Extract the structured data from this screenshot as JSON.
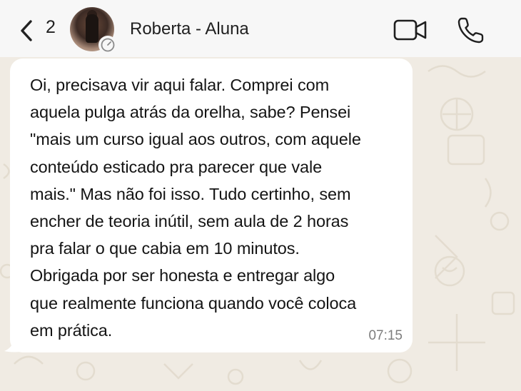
{
  "header": {
    "unread_count": "2",
    "contact_name": "Roberta - Aluna"
  },
  "icons": {
    "back": "chevron-left-icon",
    "status": "clock-icon",
    "video": "video-camera-icon",
    "call": "phone-icon"
  },
  "message": {
    "lines": [
      "Oi, precisava vir aqui falar. Comprei com",
      "aquela pulga atrás da orelha, sabe? Pensei",
      "\"mais um curso igual aos outros, com aquele",
      "conteúdo esticado pra parecer que vale",
      "mais.\" Mas não foi isso. Tudo certinho, sem",
      "encher de teoria inútil, sem aula de 2 horas",
      "pra falar o que cabia em 10 minutos.",
      "Obrigada por ser honesta e entregar algo",
      "que realmente funciona quando você coloca",
      "em prática."
    ],
    "time": "07:15"
  },
  "colors": {
    "header_bg": "#f7f7f7",
    "chat_bg": "#f0ebe3",
    "bubble_bg": "#ffffff",
    "text": "#141414",
    "time": "#7d7d7d"
  }
}
